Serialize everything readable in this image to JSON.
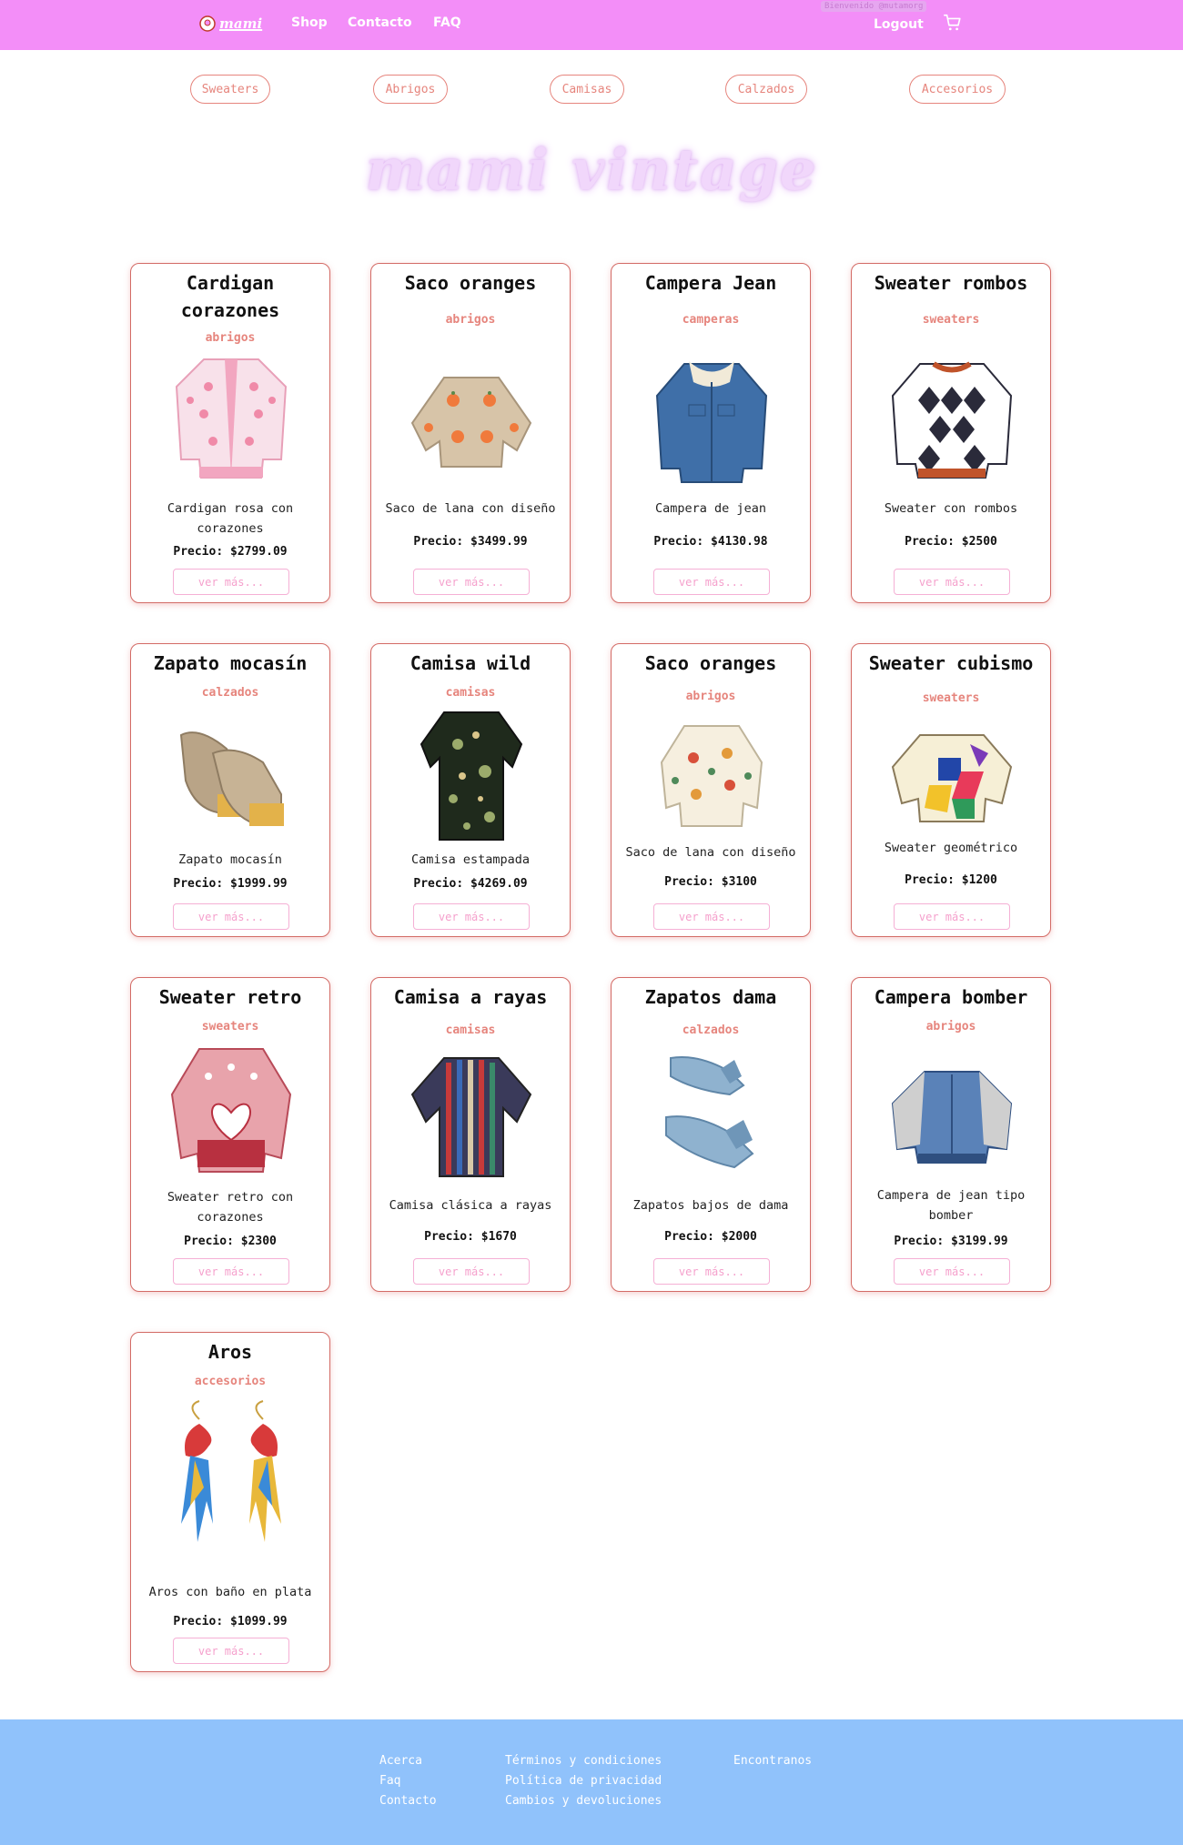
{
  "header": {
    "logo_text": "mami",
    "nav": [
      "Shop",
      "Contacto",
      "FAQ"
    ],
    "welcome": "Bienvenido @mutamorg",
    "logout": "Logout",
    "cart_icon": "shopping-cart-icon"
  },
  "categories": [
    "Sweaters",
    "Abrigos",
    "Camisas",
    "Calzados",
    "Accesorios"
  ],
  "hero_title": "mami vintage",
  "products": [
    {
      "title": "Cardigan corazones",
      "category": "abrigos",
      "description": "Cardigan rosa con corazones",
      "price": "Precio: $2799.09",
      "button": "ver más...",
      "image": "pink-heart-cardigan"
    },
    {
      "title": "Saco oranges",
      "category": "abrigos",
      "description": "Saco de lana con diseño",
      "price": "Precio: $3499.99",
      "button": "ver más...",
      "image": "orange-print-cardigan"
    },
    {
      "title": "Campera Jean",
      "category": "camperas",
      "description": "Campera de jean",
      "price": "Precio: $4130.98",
      "button": "ver más...",
      "image": "denim-jacket"
    },
    {
      "title": "Sweater rombos",
      "category": "sweaters",
      "description": "Sweater con rombos",
      "price": "Precio: $2500",
      "button": "ver más...",
      "image": "argyle-sweater"
    },
    {
      "title": "Zapato mocasín",
      "category": "calzados",
      "description": "Zapato mocasín",
      "price": "Precio: $1999.99",
      "button": "ver más...",
      "image": "platform-loafers"
    },
    {
      "title": "Camisa wild",
      "category": "camisas",
      "description": "Camisa estampada",
      "price": "Precio: $4269.09",
      "button": "ver más...",
      "image": "printed-shirt"
    },
    {
      "title": "Saco oranges",
      "category": "abrigos",
      "description": "Saco de lana con diseño",
      "price": "Precio: $3100",
      "button": "ver más...",
      "image": "heart-print-cardigan"
    },
    {
      "title": "Sweater cubismo",
      "category": "sweaters",
      "description": "Sweater geométrico",
      "price": "Precio: $1200",
      "button": "ver más...",
      "image": "geometric-sweater"
    },
    {
      "title": "Sweater retro",
      "category": "sweaters",
      "description": "Sweater retro con corazones",
      "price": "Precio: $2300",
      "button": "ver más...",
      "image": "retro-heart-sweater"
    },
    {
      "title": "Camisa a rayas",
      "category": "camisas",
      "description": "Camisa clásica a rayas",
      "price": "Precio: $1670",
      "button": "ver más...",
      "image": "striped-shirt"
    },
    {
      "title": "Zapatos dama",
      "category": "calzados",
      "description": "Zapatos bajos de dama",
      "price": "Precio: $2000",
      "button": "ver más...",
      "image": "blue-flats"
    },
    {
      "title": "Campera bomber",
      "category": "abrigos",
      "description": "Campera de jean tipo bomber",
      "price": "Precio: $3199.99",
      "button": "ver más...",
      "image": "bomber-jacket"
    },
    {
      "title": "Aros",
      "category": "accesorios",
      "description": "Aros con baño en plata",
      "price": "Precio: $1099.99",
      "button": "ver más...",
      "image": "bird-earrings"
    }
  ],
  "footer": {
    "col1": [
      "Acerca",
      "Faq",
      "Contacto"
    ],
    "col2": [
      "Términos y condiciones",
      "Política de privacidad",
      "Cambios y devoluciones"
    ],
    "col3": [
      "Encontranos"
    ]
  },
  "colors": {
    "navbar": "#f38ef8",
    "accent": "#e6857d",
    "button_text": "#f5a0cc",
    "footer": "#90c2fb"
  }
}
